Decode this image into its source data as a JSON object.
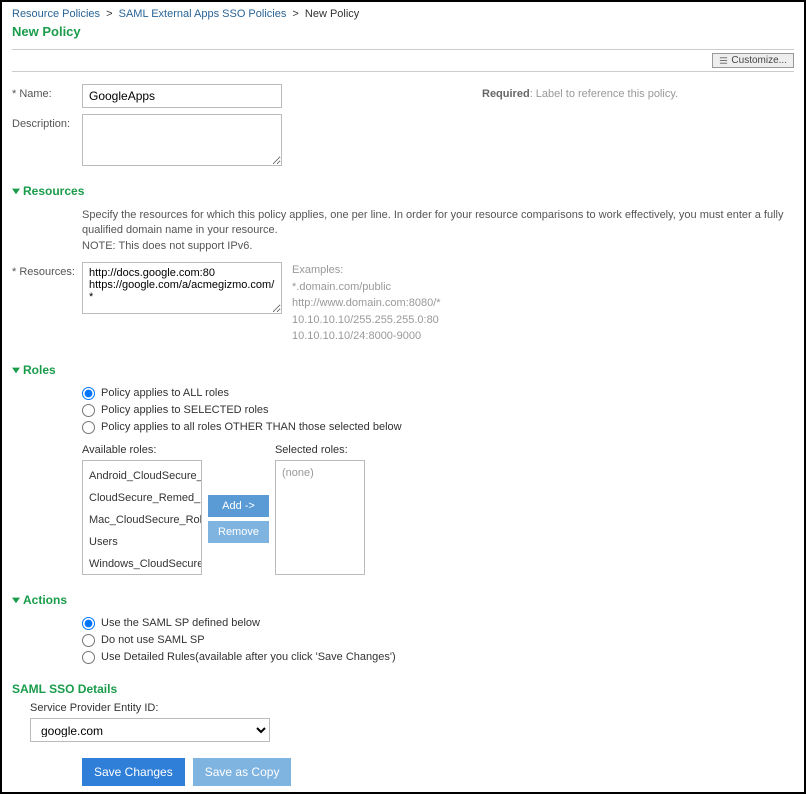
{
  "breadcrumb": {
    "items": [
      "Resource Policies",
      "SAML External Apps SSO Policies"
    ],
    "current": "New Policy"
  },
  "page_title": "New Policy",
  "customize_label": "Customize...",
  "name": {
    "label": "* Name:",
    "value": "GoogleApps"
  },
  "required_note_bold": "Required",
  "required_note_text": ": Label to reference this policy.",
  "description": {
    "label": "Description:",
    "value": ""
  },
  "sections": {
    "resources": "Resources",
    "roles": "Roles",
    "actions": "Actions"
  },
  "resources": {
    "help1": "Specify the resources for which this policy applies, one per line. In order for your resource comparisons to work effectively, you must enter a fully qualified domain name in your resource.",
    "help2": "NOTE: This does not support IPv6.",
    "label": "* Resources:",
    "value": "http://docs.google.com:80\nhttps://google.com/a/acmegizmo.com/*",
    "examples_label": "Examples:",
    "examples": [
      "*.domain.com/public",
      "http://www.domain.com:8080/*",
      "10.10.10.10/255.255.255.0:80",
      "10.10.10.10/24:8000-9000"
    ]
  },
  "roles": {
    "options": [
      "Policy applies to ALL roles",
      "Policy applies to SELECTED roles",
      "Policy applies to all roles OTHER THAN those selected below"
    ],
    "available_label": "Available roles:",
    "selected_label": "Selected roles:",
    "available": [
      "Android_CloudSecure_Role",
      "CloudSecure_Remed_Role",
      "Mac_CloudSecure_Role",
      "Users",
      "Windows_CloudSecure_Role"
    ],
    "selected_placeholder": "(none)",
    "add_label": "Add ->",
    "remove_label": "Remove"
  },
  "actions": {
    "options": [
      "Use the SAML SP defined below",
      "Do not use SAML SP",
      "Use Detailed Rules(available after you click 'Save Changes')"
    ]
  },
  "saml": {
    "header": "SAML SSO Details",
    "sp_label": "Service Provider Entity ID:",
    "sp_value": "google.com"
  },
  "buttons": {
    "save": "Save Changes",
    "save_as_copy": "Save as Copy"
  }
}
